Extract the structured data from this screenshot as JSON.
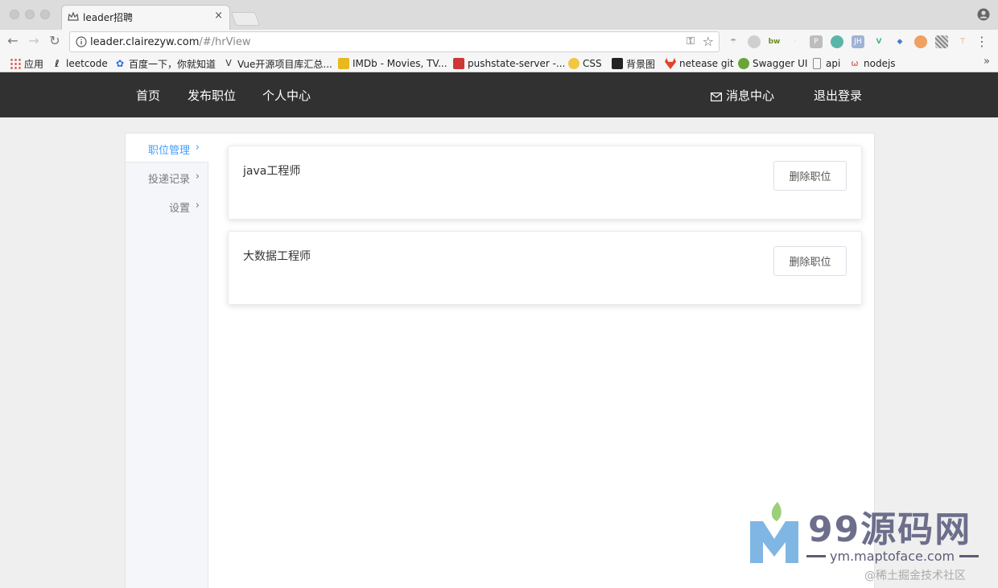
{
  "browser": {
    "tab_title": "leader招聘",
    "tab_close": "×",
    "url_host": "leader.clairezyw.com",
    "url_path": "/#/hrView",
    "bookmarks": [
      "应用",
      "leetcode",
      "百度一下，你就知道",
      "Vue开源项目库汇总...",
      "IMDb - Movies, TV...",
      "pushstate-server -...",
      "CSS",
      "背景图",
      "netease git",
      "Swagger UI",
      "api",
      "nodejs"
    ],
    "bookmarks_more": "»",
    "extensions": [
      "bw",
      "JH"
    ]
  },
  "header": {
    "nav": [
      "首页",
      "发布职位",
      "个人中心"
    ],
    "messages": "消息中心",
    "logout": "退出登录"
  },
  "sidebar": {
    "items": [
      "职位管理",
      "投递记录",
      "设置"
    ],
    "active_index": 0,
    "chevron": "›"
  },
  "jobs": [
    {
      "title": "java工程师",
      "action": "删除职位"
    },
    {
      "title": "大数据工程师",
      "action": "删除职位"
    }
  ],
  "watermark": {
    "title": "99源码网",
    "url": "ym.maptoface.com",
    "credit": "@稀土掘金技术社区"
  },
  "colors": {
    "header_bg": "#313131",
    "accent": "#409eff",
    "sidebar_bg": "#f4f6fa"
  }
}
